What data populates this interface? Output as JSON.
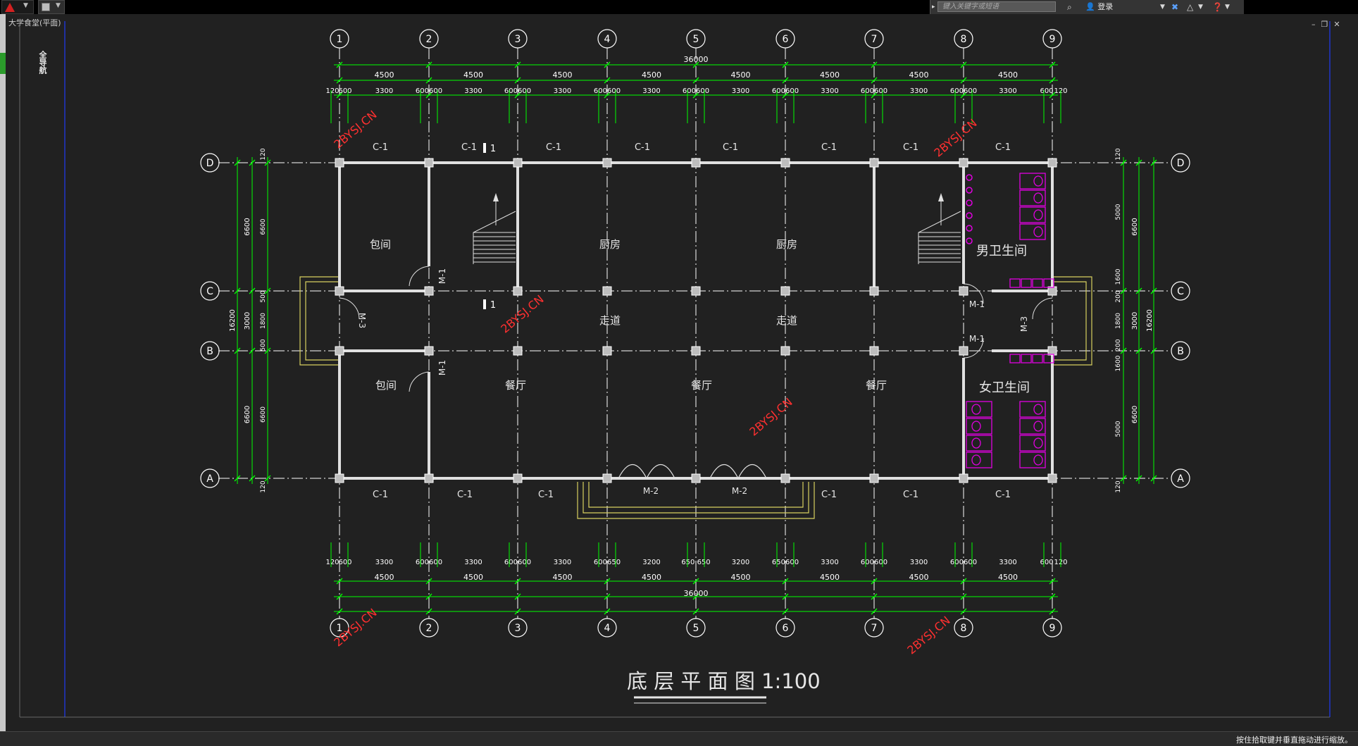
{
  "window": {
    "tab_title": "大学食堂(平面)",
    "nav_tool": "全导航"
  },
  "infocenter": {
    "search_placeholder": "键入关键字或短语",
    "login_label": "登录"
  },
  "status": {
    "prompt": "按住拾取键并垂直拖动进行缩放。"
  },
  "drawing": {
    "title": "底 层 平 面 图  1:100",
    "axes_x": [
      "1",
      "2",
      "3",
      "4",
      "5",
      "6",
      "7",
      "8",
      "9"
    ],
    "axes_y": [
      "A",
      "B",
      "C",
      "D"
    ],
    "dim_total": "36000",
    "dim_bays": [
      "4500",
      "4500",
      "4500",
      "4500",
      "4500",
      "4500",
      "4500",
      "4500"
    ],
    "dim_top_detail": [
      "120",
      "600",
      "3300",
      "600600",
      "3300",
      "600600",
      "3300",
      "600600",
      "3300",
      "600600",
      "3300",
      "600600",
      "3300",
      "600600",
      "3300",
      "600600",
      "3300",
      "600",
      "120"
    ],
    "dim_bottom_detail": [
      "120",
      "600",
      "3300",
      "600600",
      "3300",
      "600600",
      "3300",
      "600650",
      "3200",
      "650 650",
      "3200",
      "650600",
      "3300",
      "600600",
      "3300",
      "600600",
      "3300",
      "600",
      "120"
    ],
    "dim_left_outer": [
      "6600",
      "3000",
      "6600"
    ],
    "dim_left_total": "16200",
    "dim_left_inner": [
      "120",
      "6600",
      "500",
      "1800",
      "500",
      "6600",
      "120"
    ],
    "dim_right_outer": [
      "6600",
      "3000",
      "6600"
    ],
    "dim_right_total": "16200",
    "dim_right_inner": [
      "120",
      "5000",
      "1600",
      "200",
      "1800",
      "200",
      "1600",
      "5000",
      "120"
    ],
    "rooms": {
      "private1": "包间",
      "kitchen1": "厨房",
      "kitchen2": "厨房",
      "men_wc": "男卫生间",
      "corridor1": "走道",
      "corridor2": "走道",
      "private2": "包间",
      "dining1": "餐厅",
      "dining2": "餐厅",
      "dining3": "餐厅",
      "women_wc": "女卫生间"
    },
    "windows": {
      "c1": "C-1"
    },
    "doors": {
      "m1": "M-1",
      "m2": "M-2",
      "m3": "M-3"
    },
    "section_mark": "1",
    "watermark": "2BYSJ.CN"
  },
  "colors": {
    "axis": "#ffffff",
    "dim": "#00ff00",
    "wall": "#e0e0e0",
    "fixture": "#e000e0",
    "step": "#d8d060",
    "watermark": "#ff3030"
  }
}
